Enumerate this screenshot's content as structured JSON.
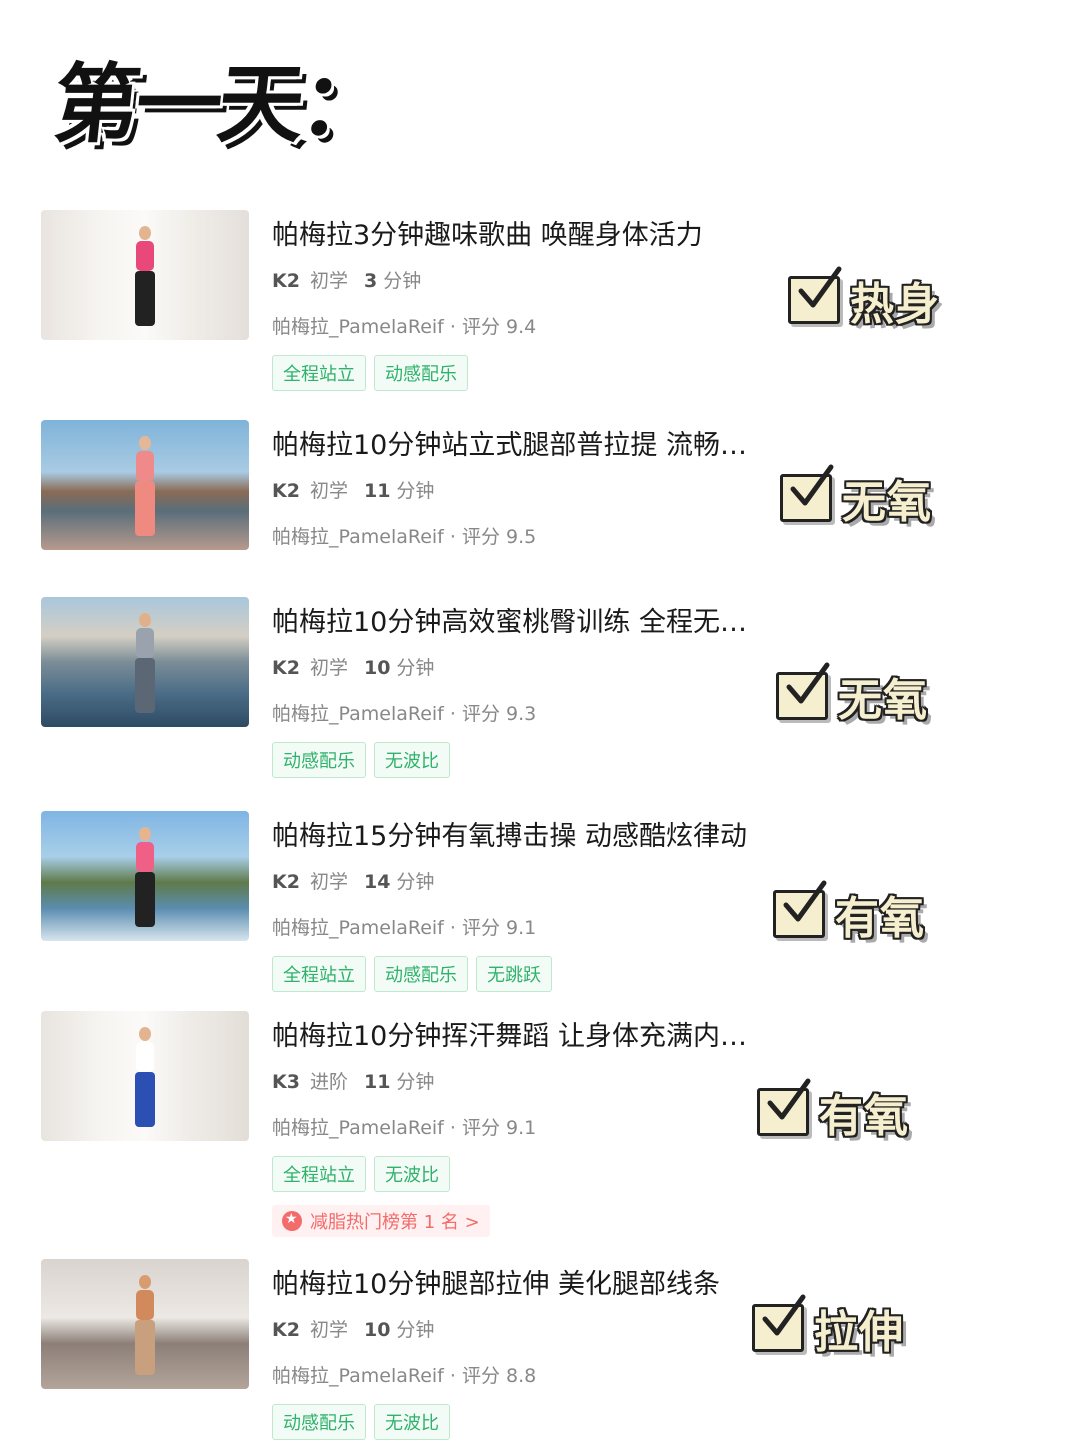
{
  "heading": "第一天：",
  "colors": {
    "tag_green": "#2fb26b",
    "badge_red": "#f36b6b",
    "stamp_fill": "#f6efcf"
  },
  "items": [
    {
      "title": "帕梅拉3分钟趣味歌曲 唤醒身体活力",
      "level": "K2",
      "level_name": "初学",
      "minutes": "3",
      "minutes_unit": "分钟",
      "author_line": "帕梅拉_PamelaReif · 评分 9.4",
      "tags": [
        "全程站立",
        "动感配乐"
      ],
      "badge": "",
      "stamp": "热身"
    },
    {
      "title": "帕梅拉10分钟站立式腿部普拉提 流畅…",
      "level": "K2",
      "level_name": "初学",
      "minutes": "11",
      "minutes_unit": "分钟",
      "author_line": "帕梅拉_PamelaReif · 评分 9.5",
      "tags": [],
      "badge": "",
      "stamp": "无氧"
    },
    {
      "title": "帕梅拉10分钟高效蜜桃臀训练 全程无…",
      "level": "K2",
      "level_name": "初学",
      "minutes": "10",
      "minutes_unit": "分钟",
      "author_line": "帕梅拉_PamelaReif · 评分 9.3",
      "tags": [
        "动感配乐",
        "无波比"
      ],
      "badge": "",
      "stamp": "无氧"
    },
    {
      "title": "帕梅拉15分钟有氧搏击操 动感酷炫律动",
      "level": "K2",
      "level_name": "初学",
      "minutes": "14",
      "minutes_unit": "分钟",
      "author_line": "帕梅拉_PamelaReif · 评分 9.1",
      "tags": [
        "全程站立",
        "动感配乐",
        "无跳跃"
      ],
      "badge": "",
      "stamp": "有氧"
    },
    {
      "title": "帕梅拉10分钟挥汗舞蹈 让身体充满内…",
      "level": "K3",
      "level_name": "进阶",
      "minutes": "11",
      "minutes_unit": "分钟",
      "author_line": "帕梅拉_PamelaReif · 评分 9.1",
      "tags": [
        "全程站立",
        "无波比"
      ],
      "badge": "减脂热门榜第 1 名 >",
      "stamp": "有氧"
    },
    {
      "title": "帕梅拉10分钟腿部拉伸 美化腿部线条",
      "level": "K2",
      "level_name": "初学",
      "minutes": "10",
      "minutes_unit": "分钟",
      "author_line": "帕梅拉_PamelaReif · 评分 8.8",
      "tags": [
        "动感配乐",
        "无波比"
      ],
      "badge": "",
      "stamp": "拉伸"
    }
  ]
}
